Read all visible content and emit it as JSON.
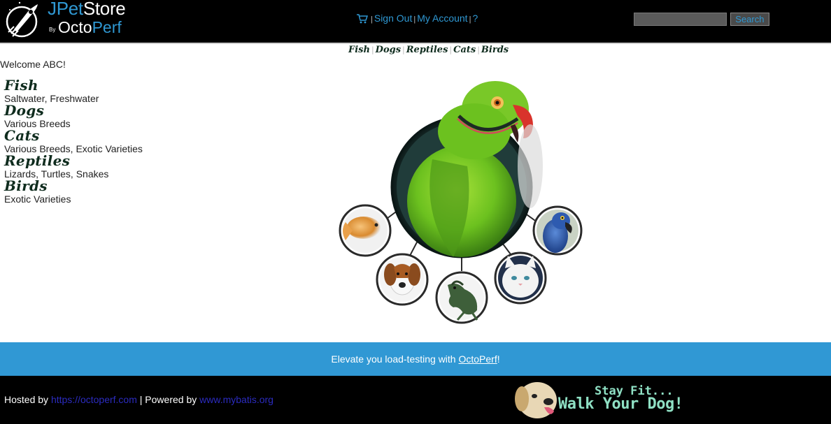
{
  "header": {
    "logo": {
      "title_prefix": "JPet",
      "title_suffix": "Store",
      "by": "By",
      "brand_prefix": "Octo",
      "brand_suffix": "Perf"
    },
    "menu": {
      "cart_icon": "cart-icon",
      "sign_out": "Sign Out",
      "my_account": "My Account",
      "help": "?",
      "separator": "|"
    },
    "search": {
      "value": "",
      "placeholder": "",
      "button_label": "Search"
    }
  },
  "quick_links": {
    "items": [
      "Fish",
      "Dogs",
      "Reptiles",
      "Cats",
      "Birds"
    ],
    "separator": "|"
  },
  "welcome": {
    "prefix": "Welcome ",
    "name": "ABC",
    "suffix": "!"
  },
  "sidebar": {
    "categories": [
      {
        "name": "Fish",
        "description": "Saltwater, Freshwater"
      },
      {
        "name": "Dogs",
        "description": "Various Breeds"
      },
      {
        "name": "Cats",
        "description": "Various Breeds, Exotic Varieties"
      },
      {
        "name": "Reptiles",
        "description": "Lizards, Turtles, Snakes"
      },
      {
        "name": "Birds",
        "description": "Exotic Varieties"
      }
    ]
  },
  "main_image": {
    "hotspots": [
      "birds",
      "fish",
      "dogs",
      "reptiles",
      "cats",
      "birds"
    ]
  },
  "promo": {
    "prefix": "Elevate you load-testing with ",
    "link": "OctoPerf",
    "suffix": "!"
  },
  "footer": {
    "hosted_by": "Hosted by ",
    "hosted_link": "https://octoperf.com",
    "separator": " | Powered by ",
    "powered_link": "www.mybatis.org",
    "banner_line1": "Stay Fit...",
    "banner_line2": "Walk Your Dog!"
  },
  "colors": {
    "header_bg": "#000000",
    "accent_blue": "#2f98d3",
    "promo_bg": "#3098d4",
    "category_green": "#0f2c1e",
    "footer_link": "#2b2bbf",
    "banner_text": "#8fe0c4"
  }
}
